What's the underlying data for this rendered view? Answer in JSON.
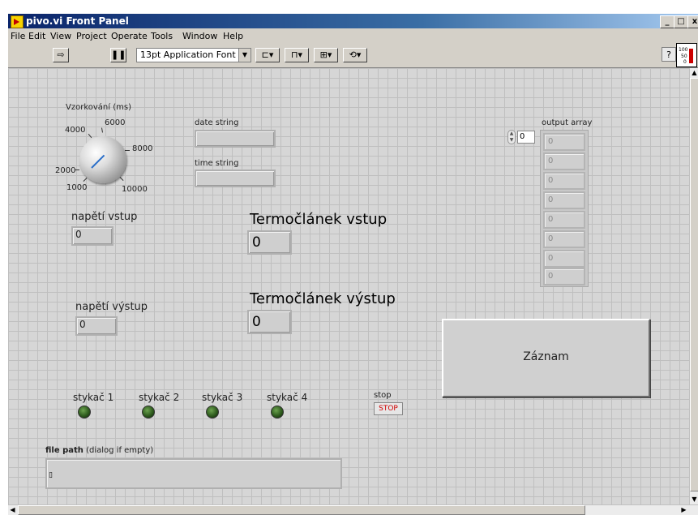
{
  "window": {
    "title": "pivo.vi Front Panel",
    "min": "_",
    "max": "□",
    "close": "x"
  },
  "menu": [
    "File",
    "Edit",
    "View",
    "Project",
    "Operate",
    "Tools",
    "Window",
    "Help"
  ],
  "toolbar": {
    "font": "13pt Application Font",
    "help": "?"
  },
  "vi_icon": {
    "l1": "100",
    "l2": "50",
    "l3": "0"
  },
  "knob": {
    "label": "Vzorkování (ms)",
    "ticks": [
      "1000",
      "2000",
      "4000",
      "6000",
      "8000",
      "10000"
    ]
  },
  "strings": {
    "date_label": "date string",
    "time_label": "time string"
  },
  "voltage_in": {
    "label": "napětí vstup",
    "value": "0"
  },
  "voltage_out": {
    "label": "napětí výstup",
    "value": "0"
  },
  "thermo_in": {
    "label": "Termočlánek vstup",
    "value": "0"
  },
  "thermo_out": {
    "label": "Termočlánek výstup",
    "value": "0"
  },
  "output_array": {
    "label": "output array",
    "index": "0",
    "values": [
      "0",
      "0",
      "0",
      "0",
      "0",
      "0",
      "0",
      "0"
    ]
  },
  "record_button": {
    "label": "Záznam"
  },
  "leds": [
    "stykač 1",
    "stykač 2",
    "stykač 3",
    "stykač 4"
  ],
  "stop": {
    "label": "stop",
    "button": "STOP"
  },
  "file_path": {
    "label_bold": "file path",
    "label_rest": " (dialog if empty)"
  }
}
